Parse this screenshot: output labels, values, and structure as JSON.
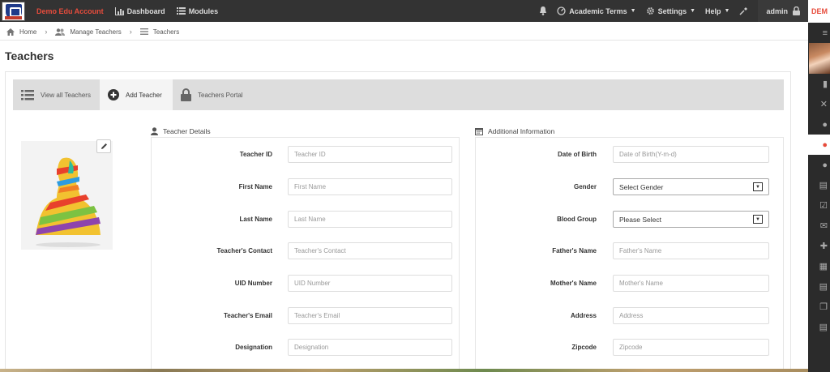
{
  "topbar": {
    "brand": "Demo Edu Account",
    "dashboard": "Dashboard",
    "modules": "Modules",
    "academic_terms": "Academic Terms",
    "settings": "Settings",
    "help": "Help",
    "user": "admin"
  },
  "rightbar": {
    "label": "DEM"
  },
  "breadcrumb": {
    "home": "Home",
    "manage_teachers": "Manage Teachers",
    "teachers": "Teachers"
  },
  "page": {
    "title": "Teachers"
  },
  "tabs": [
    {
      "label": "View all Teachers"
    },
    {
      "label": "Add Teacher"
    },
    {
      "label": "Teachers Portal"
    }
  ],
  "teacher_details": {
    "title": "Teacher Details",
    "fields": [
      {
        "label": "Teacher ID",
        "placeholder": "Teacher ID"
      },
      {
        "label": "First Name",
        "placeholder": "First Name"
      },
      {
        "label": "Last Name",
        "placeholder": "Last Name"
      },
      {
        "label": "Teacher's Contact",
        "placeholder": "Teacher's Contact"
      },
      {
        "label": "UID Number",
        "placeholder": "UID Number"
      },
      {
        "label": "Teacher's Email",
        "placeholder": "Teacher's Email"
      },
      {
        "label": "Designation",
        "placeholder": "Designation"
      }
    ]
  },
  "additional_info": {
    "title": "Additional Information",
    "dob": {
      "label": "Date of Birth",
      "placeholder": "Date of Birth(Y-m-d)"
    },
    "gender": {
      "label": "Gender",
      "value": "Select Gender"
    },
    "blood_group": {
      "label": "Blood Group",
      "value": "Please Select"
    },
    "father": {
      "label": "Father's Name",
      "placeholder": "Father's Name"
    },
    "mother": {
      "label": "Mother's Name",
      "placeholder": "Mother's Name"
    },
    "address": {
      "label": "Address",
      "placeholder": "Address"
    },
    "zipcode": {
      "label": "Zipcode",
      "placeholder": "Zipcode"
    }
  },
  "colors": {
    "topbar": "#333333",
    "brand": "#e74c3c",
    "tabs_bg": "#dddddd"
  }
}
